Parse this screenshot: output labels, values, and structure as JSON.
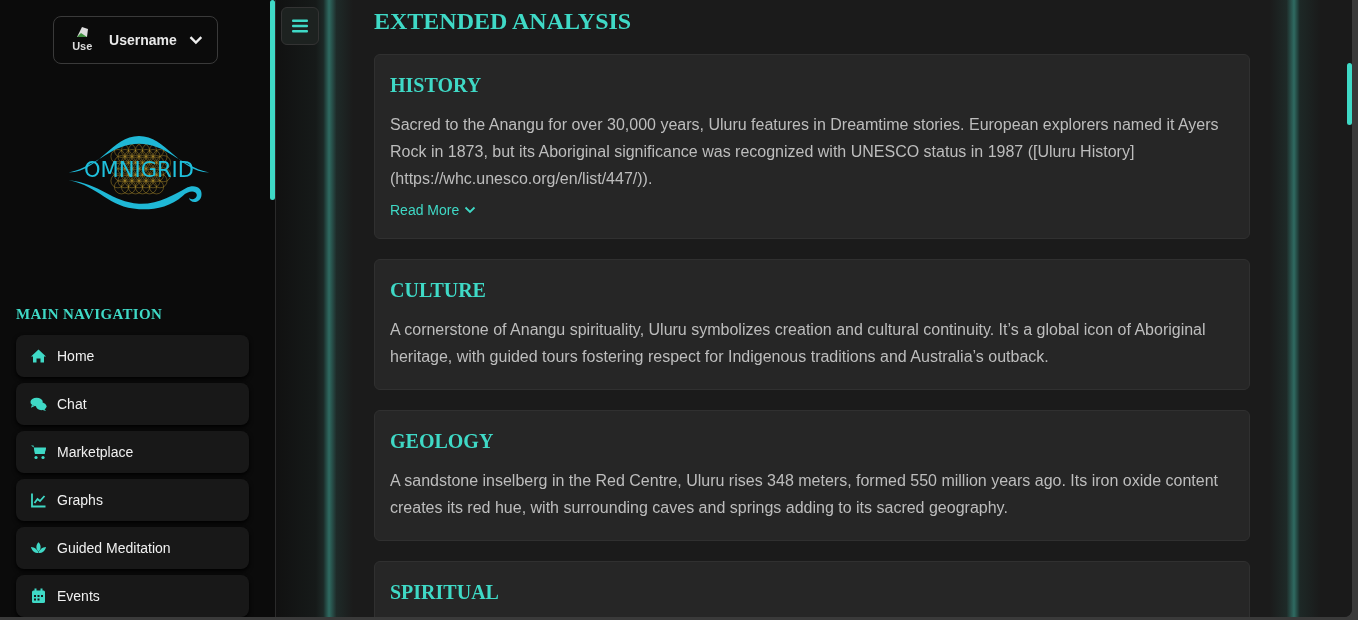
{
  "user": {
    "avatar_alt": "Use",
    "name": "Username"
  },
  "logo": {
    "text": "OMNIGRID"
  },
  "navigation": {
    "title": "MAIN NAVIGATION",
    "items": [
      {
        "label": "Home",
        "kind": "home"
      },
      {
        "label": "Chat",
        "kind": "chat"
      },
      {
        "label": "Marketplace",
        "kind": "cart"
      },
      {
        "label": "Graphs",
        "kind": "chart"
      },
      {
        "label": "Guided Meditation",
        "kind": "lotus"
      },
      {
        "label": "Events",
        "kind": "calendar"
      }
    ]
  },
  "main": {
    "title": "EXTENDED ANALYSIS",
    "sections": [
      {
        "title": "HISTORY",
        "text": "Sacred to the Anangu for over 30,000 years, Uluru features in Dreamtime stories. European explorers named it Ayers Rock in 1873, but its Aboriginal significance was recognized with UNESCO status in 1987 ([Uluru History](https://whc.unesco.org/en/list/447/)).",
        "link": "Read More"
      },
      {
        "title": "CULTURE",
        "text": "A cornerstone of Anangu spirituality, Uluru symbolizes creation and cultural continuity. It’s a global icon of Aboriginal heritage, with guided tours fostering respect for Indigenous traditions and Australia’s outback."
      },
      {
        "title": "GEOLOGY",
        "text": "A sandstone inselberg in the Red Centre, Uluru rises 348 meters, formed 550 million years ago. Its iron oxide content creates its red hue, with surrounding caves and springs adding to its sacred geography."
      },
      {
        "title": "SPIRITUAL"
      }
    ]
  }
}
